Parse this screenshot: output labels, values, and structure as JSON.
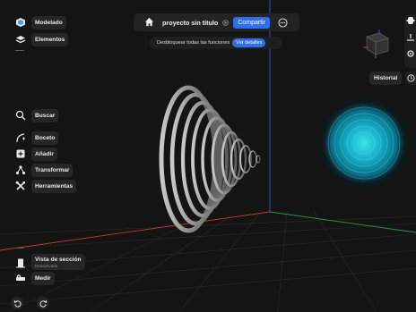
{
  "left_toolbar": {
    "top_items": [
      {
        "label": "Modelado",
        "icon": "layers-hex-icon"
      },
      {
        "label": "Elementos",
        "icon": "stack-icon"
      }
    ],
    "mid_items": [
      {
        "label": "Buscar",
        "icon": "search-icon"
      },
      {
        "label": "Boceto",
        "icon": "sketch-curve-icon"
      },
      {
        "label": "Añadir",
        "icon": "add-box-icon"
      },
      {
        "label": "Transformar",
        "icon": "transform-nodes-icon"
      },
      {
        "label": "Herramientas",
        "icon": "tools-icon"
      }
    ],
    "section_view": {
      "label": "Vista de sección",
      "sublabel": "Desactivado",
      "icon": "section-view-icon"
    },
    "measure": {
      "label": "Medir",
      "icon": "measure-icon"
    },
    "undo_icon": "undo-icon",
    "redo_icon": "redo-icon"
  },
  "topbar": {
    "home_icon": "home-icon",
    "title": "proyecto sin título",
    "status_icon": "cloud-status-icon",
    "share_label": "Compartir",
    "more_icon": "more-options-icon"
  },
  "unlock": {
    "text": "Desbloquear todas las funciones",
    "button": "Ver detalles"
  },
  "right_toolbar": {
    "history_label": "Historial",
    "icons": [
      "settings-icon",
      "sliders-icon",
      "gear-small-icon",
      "clock-icon"
    ],
    "view_cube_icon": "view-cube-icon"
  },
  "colors": {
    "accent": "#2f6fed",
    "axis_blue": "#2b5fd9",
    "axis_red": "#c2392f",
    "axis_green": "#2f9a3a",
    "glow": "#22c3dd"
  }
}
